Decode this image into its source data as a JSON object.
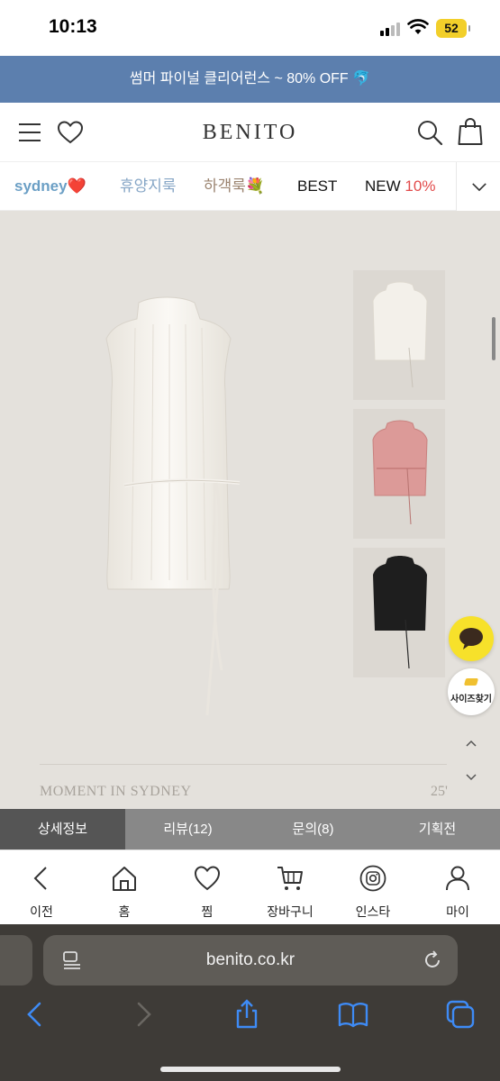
{
  "status_bar": {
    "time": "10:13",
    "battery": "52"
  },
  "promo": {
    "text": "썸머 파이널 클리어런스 ~ 80% OFF 🐬"
  },
  "header": {
    "logo": "BENITO"
  },
  "category_nav": {
    "items": [
      {
        "label": "sydney❤️",
        "color": "#6b9fc5"
      },
      {
        "label": "휴양지룩",
        "color": "#86a6c6"
      },
      {
        "label": "하객룩💐",
        "color": "#9b8470"
      },
      {
        "label": "BEST"
      },
      {
        "label": "NEW",
        "accent": "10%",
        "accent_color": "#e24b4b"
      }
    ]
  },
  "product": {
    "collection_text": "MOMENT IN SYDNEY",
    "year_text": "25'",
    "thumbnails": [
      {
        "color_name": "ivory",
        "color": "#f3f0ea"
      },
      {
        "color_name": "pink",
        "color": "#dc9a98"
      },
      {
        "color_name": "black",
        "color": "#1e1e1e"
      }
    ],
    "size_button_label": "사이즈찾기"
  },
  "tabs": [
    {
      "label": "상세정보",
      "active": true
    },
    {
      "label": "리뷰(12)"
    },
    {
      "label": "문의(8)"
    },
    {
      "label": "기획전"
    }
  ],
  "bottom_bar": [
    {
      "label": "이전",
      "icon": "back-arrow-icon"
    },
    {
      "label": "홈",
      "icon": "home-icon"
    },
    {
      "label": "찜",
      "icon": "heart-icon"
    },
    {
      "label": "장바구니",
      "icon": "cart-icon"
    },
    {
      "label": "인스타",
      "icon": "instagram-icon"
    },
    {
      "label": "마이",
      "icon": "user-icon"
    }
  ],
  "safari": {
    "url": "benito.co.kr"
  },
  "colors": {
    "promo_bg": "#5c7fae",
    "tab_active": "#555555",
    "tab_bg": "#888888",
    "kakao": "#f7e12a"
  }
}
